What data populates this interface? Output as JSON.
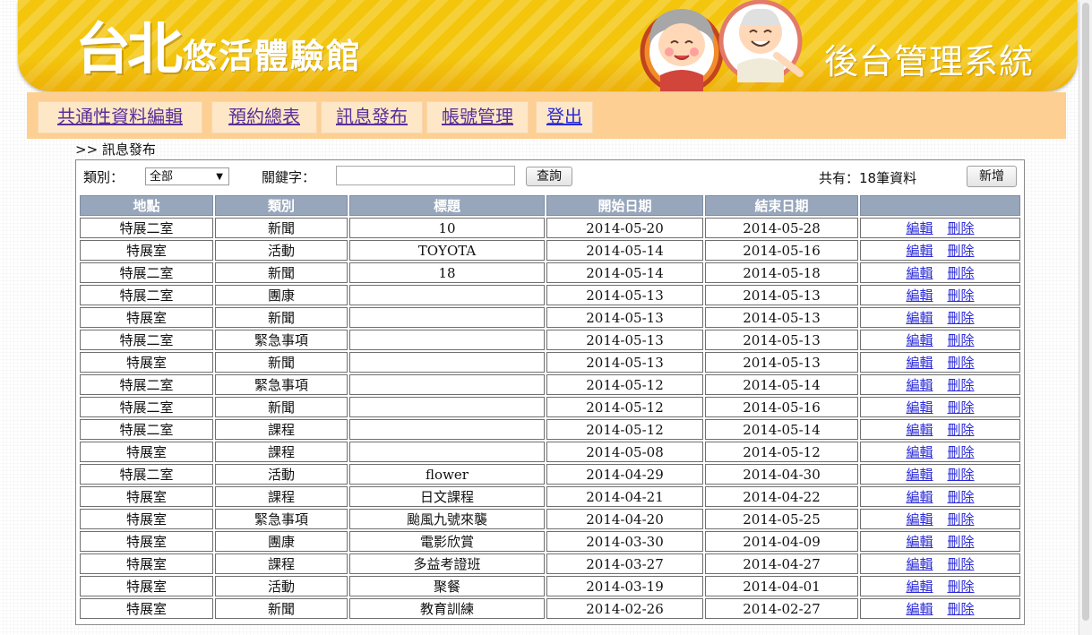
{
  "header": {
    "logo_big": "台北",
    "logo_small": "悠活體驗館",
    "system_title": "後台管理系統",
    "colors": {
      "banner": "#f3c60d",
      "nav": "#fdcf92",
      "table_header": "#97a6bb",
      "link": "#2a2ad8"
    }
  },
  "nav": {
    "items": [
      {
        "label": "共通性資料編輯"
      },
      {
        "label": "預約總表"
      },
      {
        "label": "訊息發布"
      },
      {
        "label": "帳號管理"
      },
      {
        "label": "登出"
      }
    ]
  },
  "breadcrumb": ">> 訊息發布",
  "filter": {
    "category_label": "類別：",
    "category_value": "全部",
    "keyword_label": "關鍵字：",
    "keyword_value": "",
    "search_button": "查詢",
    "total_text": "共有：18筆資料",
    "add_button": "新增"
  },
  "table": {
    "headers": [
      "地點",
      "類別",
      "標題",
      "開始日期",
      "結束日期",
      ""
    ],
    "edit_label": "編輯",
    "delete_label": "刪除",
    "rows": [
      [
        "特展二室",
        "新聞",
        "10",
        "2014-05-20",
        "2014-05-28"
      ],
      [
        "特展室",
        "活動",
        "TOYOTA",
        "2014-05-14",
        "2014-05-16"
      ],
      [
        "特展二室",
        "新聞",
        "18",
        "2014-05-14",
        "2014-05-18"
      ],
      [
        "特展二室",
        "團康",
        "",
        "2014-05-13",
        "2014-05-13"
      ],
      [
        "特展室",
        "新聞",
        "",
        "2014-05-13",
        "2014-05-13"
      ],
      [
        "特展二室",
        "緊急事項",
        "",
        "2014-05-13",
        "2014-05-13"
      ],
      [
        "特展室",
        "新聞",
        "",
        "2014-05-13",
        "2014-05-13"
      ],
      [
        "特展二室",
        "緊急事項",
        "",
        "2014-05-12",
        "2014-05-14"
      ],
      [
        "特展二室",
        "新聞",
        "",
        "2014-05-12",
        "2014-05-16"
      ],
      [
        "特展二室",
        "課程",
        "",
        "2014-05-12",
        "2014-05-14"
      ],
      [
        "特展室",
        "課程",
        "",
        "2014-05-08",
        "2014-05-12"
      ],
      [
        "特展二室",
        "活動",
        "flower",
        "2014-04-29",
        "2014-04-30"
      ],
      [
        "特展室",
        "課程",
        "日文課程",
        "2014-04-21",
        "2014-04-22"
      ],
      [
        "特展室",
        "緊急事項",
        "颱風九號來襲",
        "2014-04-20",
        "2014-05-25"
      ],
      [
        "特展室",
        "團康",
        "電影欣賞",
        "2014-03-30",
        "2014-04-09"
      ],
      [
        "特展室",
        "課程",
        "多益考證班",
        "2014-03-27",
        "2014-04-27"
      ],
      [
        "特展室",
        "活動",
        "聚餐",
        "2014-03-19",
        "2014-04-01"
      ],
      [
        "特展室",
        "新聞",
        "教育訓練",
        "2014-02-26",
        "2014-02-27"
      ]
    ]
  }
}
